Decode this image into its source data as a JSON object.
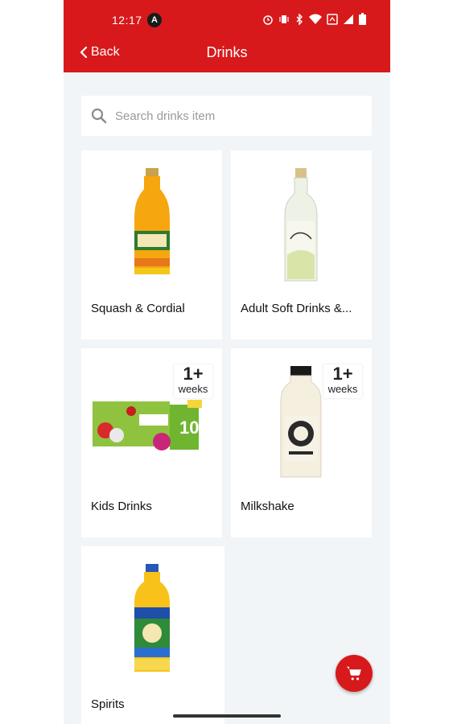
{
  "status_bar": {
    "time": "12:17",
    "badge": "A"
  },
  "header": {
    "back_label": "Back",
    "title": "Drinks"
  },
  "search": {
    "placeholder": "Search drinks item",
    "value": ""
  },
  "categories": [
    {
      "label": "Squash & Cordial",
      "badge_top": "",
      "badge_bottom": ""
    },
    {
      "label": "Adult Soft Drinks &...",
      "badge_top": "",
      "badge_bottom": ""
    },
    {
      "label": "Kids Drinks",
      "badge_top": "1+",
      "badge_bottom": "weeks"
    },
    {
      "label": "Milkshake",
      "badge_top": "1+",
      "badge_bottom": "weeks"
    },
    {
      "label": "Spirits",
      "badge_top": "",
      "badge_bottom": ""
    }
  ],
  "colors": {
    "brand_red": "#d7191c",
    "background": "#f2f5f7"
  },
  "icons": [
    "chevron-left-icon",
    "search-icon",
    "cart-icon"
  ]
}
